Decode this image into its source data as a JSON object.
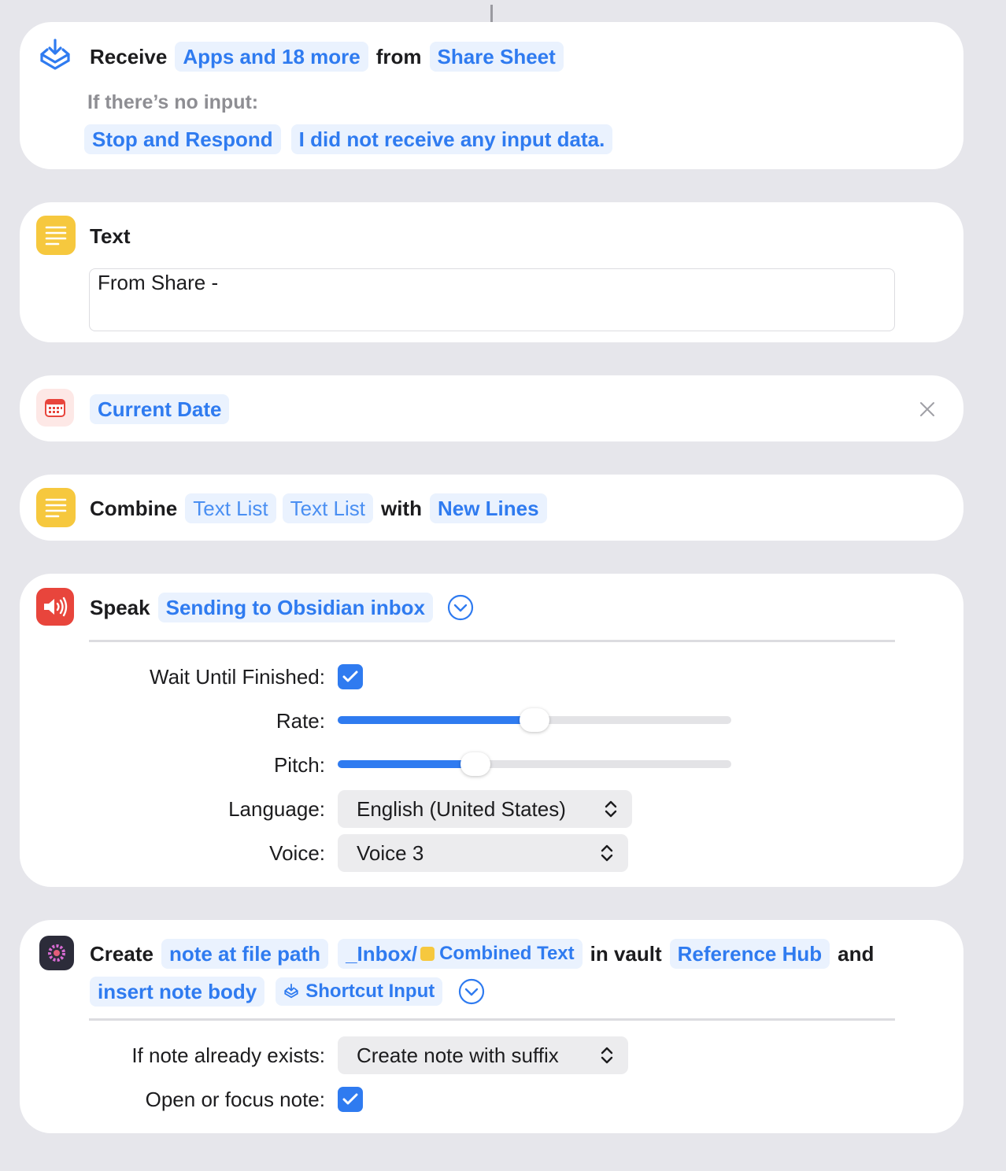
{
  "receive": {
    "verb": "Receive",
    "input_types": "Apps and 18 more",
    "from_word": "from",
    "source": "Share Sheet",
    "no_input_label": "If there’s no input:",
    "no_input_action": "Stop and Respond",
    "no_input_message": "I did not receive any input data."
  },
  "text_action": {
    "title": "Text",
    "value": "From Share -"
  },
  "current_date": {
    "label": "Current Date"
  },
  "combine": {
    "verb": "Combine",
    "item1": "Text List",
    "item2": "Text List",
    "with_word": "with",
    "separator": "New Lines"
  },
  "speak": {
    "verb": "Speak",
    "text": "Sending to Obsidian inbox",
    "wait_label": "Wait Until Finished:",
    "wait_checked": true,
    "rate_label": "Rate:",
    "rate_value": 0.5,
    "pitch_label": "Pitch:",
    "pitch_value": 0.35,
    "language_label": "Language:",
    "language_value": "English (United States)",
    "voice_label": "Voice:",
    "voice_value": "Voice 3"
  },
  "create_note": {
    "verb": "Create",
    "mode": "note at file path",
    "path_prefix": "_Inbox/",
    "path_variable": "Combined Text",
    "in_vault_word": "in vault",
    "vault": "Reference Hub",
    "and_word": "and",
    "body_mode": "insert note body",
    "body_variable": "Shortcut Input",
    "exists_label": "If note already exists:",
    "exists_value": "Create note with suffix",
    "open_label": "Open or focus note:",
    "open_checked": true
  },
  "colors": {
    "accent": "#2f7bf0",
    "pill_bg": "#eaf2fe",
    "text_icon": "#f6c83e",
    "speak_icon": "#e8453c",
    "background": "#e6e6eb"
  }
}
